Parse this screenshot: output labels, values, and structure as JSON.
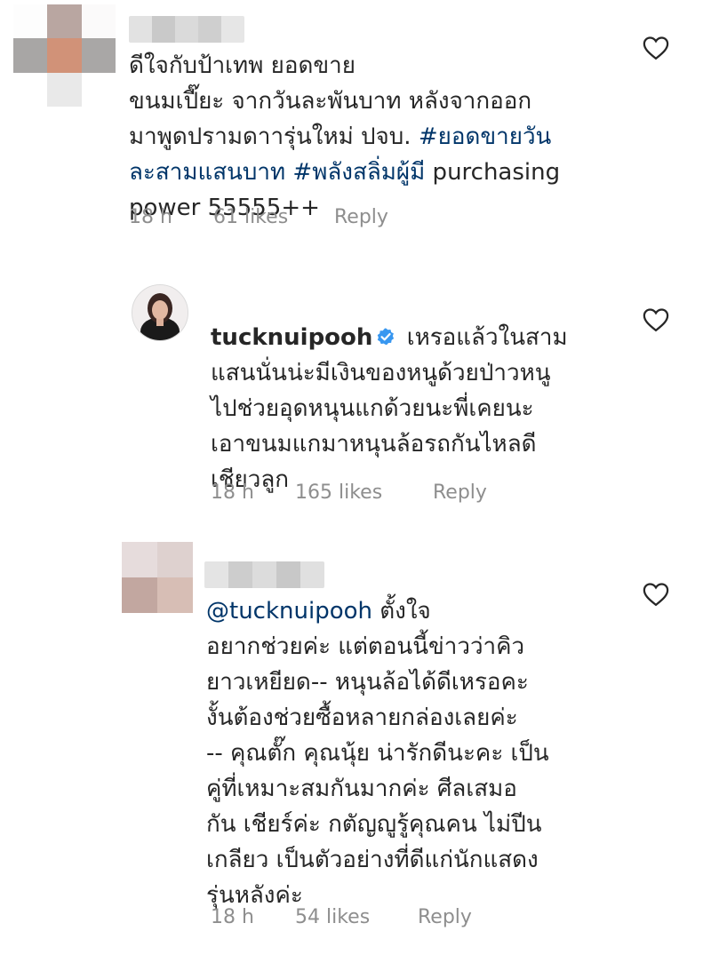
{
  "colors": {
    "text": "#262626",
    "meta": "#8e8e8e",
    "hashtag": "#003569",
    "verified": "#3897f0"
  },
  "comments": [
    {
      "text_prefix": "ดีใจกับป้าเทพ ยอดขาย\nขนมเปี๊ยะ จากวันละพันบาท หลังจากออก\nมาพูดปรามดาารุ่นใหม่ ปจบ. ",
      "hashtag1": "#ยอดขายวัน\nละสามแสนบาท",
      "space": " ",
      "hashtag2": "#พลังสลิ่มผู้มี",
      "text_suffix": " purchasing\npower 55555++",
      "time": "18 h",
      "likes": "61 likes",
      "reply": "Reply",
      "like_icon": "heart-outline-icon"
    },
    {
      "username": "tucknuipooh",
      "verified_icon": "verified-badge-icon",
      "text": "เหรอแล้วในสาม\nแสนนั่นน่ะมีเงินของหนูด้วยป่าวหนู\nไปช่วยอุดหนุนแกด้วยนะพี่เคยนะ\nเอาขนมแกมาหนุนล้อรถกันไหลดี\nเชียวลูก",
      "time": "18 h",
      "likes": "165 likes",
      "reply": "Reply",
      "like_icon": "heart-outline-icon"
    },
    {
      "mention": "@tucknuipooh",
      "text": "ตั้งใจ\nอยากช่วยค่ะ แต่ตอนนี้ข่าวว่าคิว\nยาวเหยียด-- หนุนล้อได้ดีเหรอคะ\nงั้นต้องช่วยซื้อหลายกล่องเลยค่ะ\n-- คุณตั๊ก คุณนุ้ย น่ารักดีนะคะ เป็น\nคู่ที่เหมาะสมกันมากค่ะ  ศีลเสมอ\nกัน เชียร์ค่ะ กตัญญูรู้คุณคน  ไม่ปีน\nเกลียว เป็นตัวอย่างที่ดีแก่นักแสดง\nรุ่นหลังค่ะ",
      "time": "18 h",
      "likes": "54 likes",
      "reply": "Reply",
      "like_icon": "heart-outline-icon"
    }
  ]
}
